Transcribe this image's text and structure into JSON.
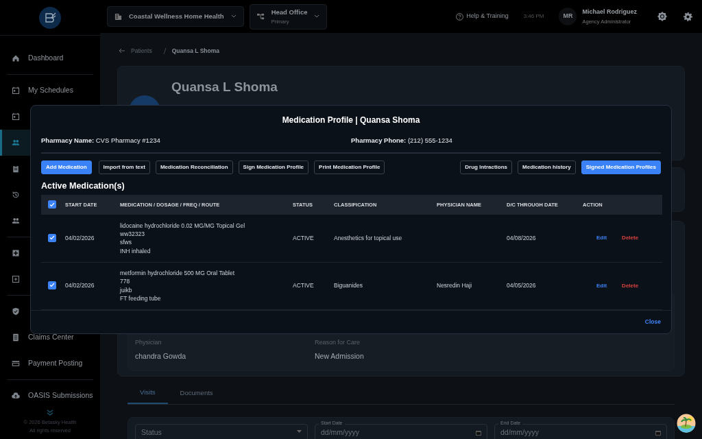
{
  "sidebar": {
    "items": [
      {
        "label": "Dashboard",
        "selected": false
      },
      {
        "label": "My Schedules",
        "selected": false
      },
      {
        "selected": false
      },
      {
        "selected": true
      },
      {
        "selected": false
      },
      {
        "selected": false
      },
      {
        "selected": false
      },
      {
        "selected": false
      },
      {
        "selected": false
      },
      {
        "selected": false
      },
      {
        "label": "Claims Center",
        "selected": false
      },
      {
        "label": "Payment Posting",
        "selected": false
      },
      {
        "label": "OASIS Submissions",
        "selected": false
      }
    ],
    "footer": [
      "© 2026 Betasky Health",
      "All rights reserved"
    ]
  },
  "topbar": {
    "agency": "Coastal Wellness Home Health",
    "office": {
      "title": "Head Office",
      "subtitle": "Primary"
    },
    "help": "Help & Training",
    "time": "3:46 PM",
    "user": {
      "initials": "MR",
      "name": "Michael Rodriguez",
      "role": "Agency Administrator"
    }
  },
  "breadcrumb": {
    "parent": "Patients",
    "current": "Quansa L Shoma"
  },
  "patient": {
    "name": "Quansa L Shoma"
  },
  "details": [
    {
      "label": "Physician",
      "value": "chandra Gowda"
    },
    {
      "label": "Reason for Care",
      "value": "New Admission"
    }
  ],
  "tabs": [
    {
      "label": "Visits",
      "selected": true
    },
    {
      "label": "Documents",
      "selected": false
    }
  ],
  "filters": [
    {
      "kind": "select",
      "placeholder": "Status"
    },
    {
      "kind": "date",
      "label": "Start Date",
      "placeholder": "dd/mm/yyyy"
    },
    {
      "kind": "date",
      "label": "End Date",
      "placeholder": "dd/mm/yyyy"
    }
  ],
  "modal": {
    "title": "Medication Profile | Quansa Shoma",
    "pharmacy": [
      {
        "label": "Pharmacy Name:",
        "value": "CVS Pharmacy #1234"
      },
      {
        "label": "Pharmacy Phone:",
        "value": "(212) 555-1234"
      }
    ],
    "toolbar_left": [
      {
        "label": "Add Medication",
        "kind": "primary"
      },
      {
        "label": "Import from text",
        "kind": "outline"
      },
      {
        "label": "Medication Reconciliation",
        "kind": "outline"
      },
      {
        "label": "Sign Medication Profile",
        "kind": "outline"
      },
      {
        "label": "Print Medication Profile",
        "kind": "outline"
      }
    ],
    "toolbar_right": [
      {
        "label": "Drug Intractions",
        "kind": "outline"
      },
      {
        "label": "Medication history",
        "kind": "outline"
      },
      {
        "label": "Signed Medication Profiles",
        "kind": "primary"
      }
    ],
    "section_title": "Active Medication(s)",
    "table": {
      "all_selected": true,
      "columns": [
        "START DATE",
        "MEDICATION / DOSAGE / FREQ / ROUTE",
        "STATUS",
        "CLASSIFICATION",
        "PHYSICIAN NAME",
        "D/C THROUGH DATE",
        "ACTION"
      ],
      "rows": [
        {
          "selected": true,
          "start_date": "04/02/2026",
          "medication": [
            "lidocaine hydrochloride 0.02 MG/MG Topical Gel",
            "ww32323",
            "sfws",
            "INH inhaled"
          ],
          "status": "ACTIVE",
          "classification": "Anesthetics for topical use",
          "dc_date": "04/08/2026",
          "actions": [
            {
              "label": "Edit",
              "kind": "edit"
            },
            {
              "label": "Delete",
              "kind": "delete"
            }
          ]
        },
        {
          "selected": true,
          "start_date": "04/02/2026",
          "medication": [
            "metformin hydrochloride 500 MG Oral Tablet",
            "778",
            "juikb",
            "FT feeding tube"
          ],
          "status": "ACTIVE",
          "classification": "Biguanides",
          "physician": "Nesredin Haji",
          "dc_date": "04/05/2026",
          "actions": [
            {
              "label": "Edit",
              "kind": "edit"
            },
            {
              "label": "Delete",
              "kind": "delete"
            }
          ]
        }
      ]
    },
    "close": "Close"
  }
}
